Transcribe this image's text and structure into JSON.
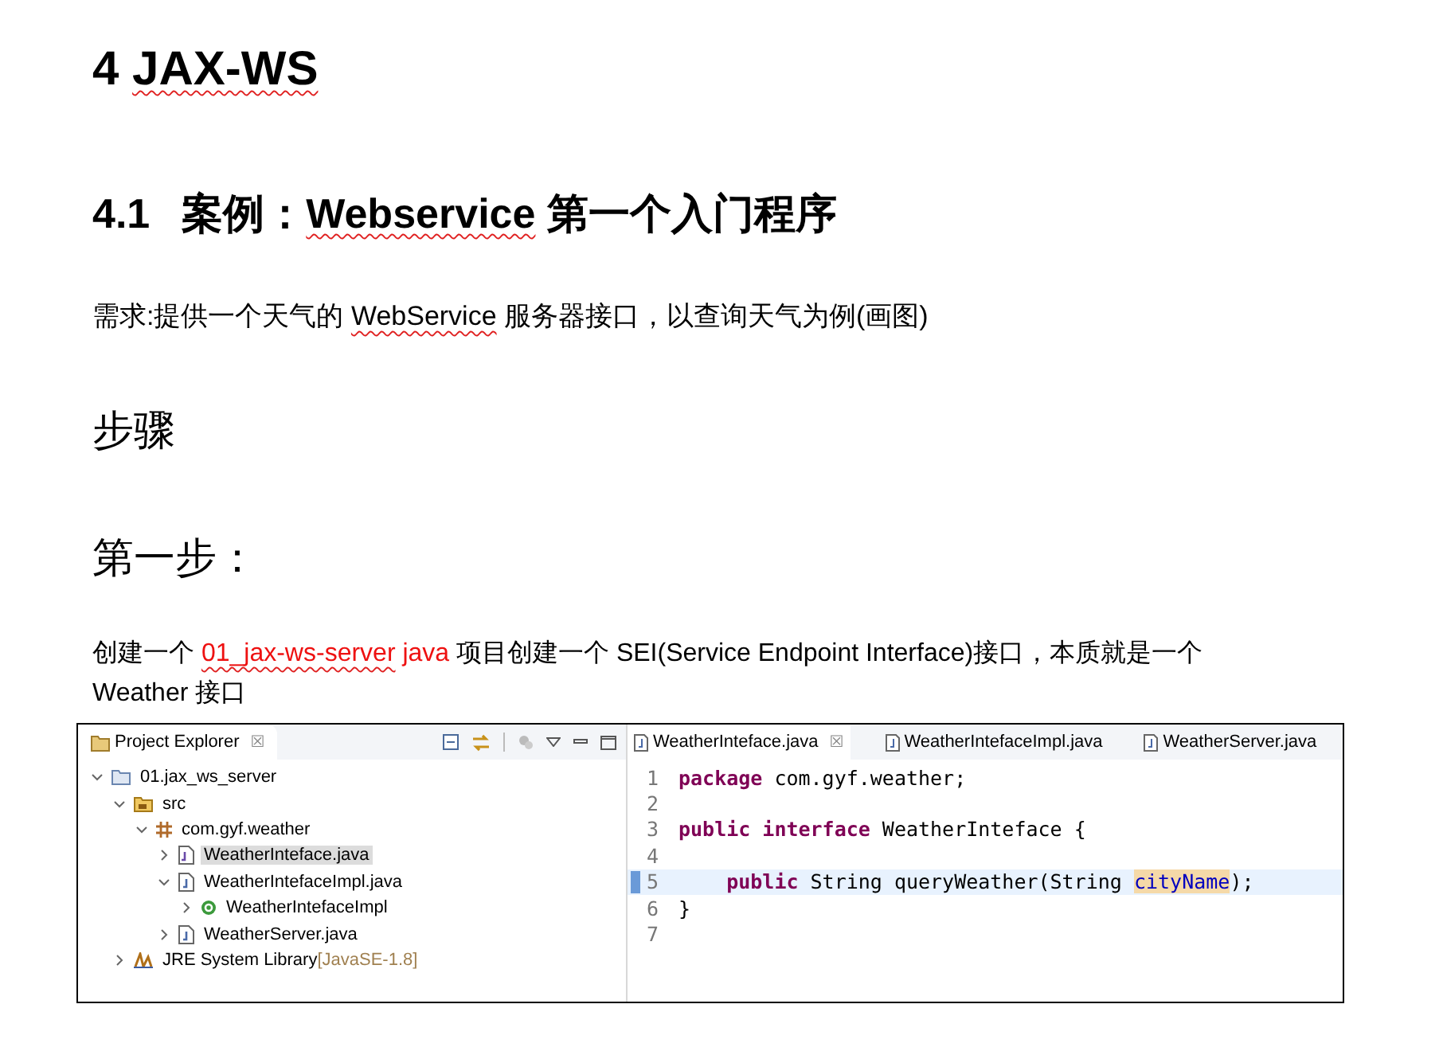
{
  "heading1": [
    {
      "text": "4 ",
      "misspelled": false
    },
    {
      "text": "JAX-WS",
      "misspelled": true
    }
  ],
  "heading2": {
    "number": "4.1",
    "title": [
      {
        "text": "案例：",
        "misspelled": false
      },
      {
        "text": "Webservice",
        "misspelled": true
      },
      {
        "text": " 第一个入门程序",
        "misspelled": false
      }
    ]
  },
  "requirement": [
    {
      "text": "需求:提供一个天气的 ",
      "misspelled": false
    },
    {
      "text": "WebService",
      "misspelled": true
    },
    {
      "text": " 服务器接口，以查询天气为例(画图)",
      "misspelled": false
    }
  ],
  "heading_steps": "步骤",
  "heading_step1": "第一步：",
  "paragraph": [
    {
      "text": "创建一个 ",
      "kind": "plain",
      "misspelled": false
    },
    {
      "text": "01_jax-ws-server",
      "kind": "red",
      "misspelled": true
    },
    {
      "text": " java",
      "kind": "red",
      "misspelled": false
    },
    {
      "text": " 项目创建一个 SEI(Service Endpoint Interface)接口，本质就是一个 Weather 接口",
      "kind": "plain",
      "misspelled": false
    }
  ],
  "ide": {
    "explorer": {
      "title": "Project Explorer",
      "close": "☒",
      "tree": [
        {
          "label": "01.jax_ws_server",
          "kind": "project",
          "expanded": true,
          "selected": false,
          "children": [
            {
              "label": "src",
              "kind": "source",
              "expanded": true,
              "selected": false,
              "children": [
                {
                  "label": "com.gyf.weather",
                  "kind": "package",
                  "expanded": true,
                  "selected": false,
                  "children": [
                    {
                      "label": "WeatherInteface.java",
                      "kind": "interface-file",
                      "expanded": false,
                      "selected": true
                    },
                    {
                      "label": "WeatherIntefaceImpl.java",
                      "kind": "java-file",
                      "expanded": true,
                      "selected": false,
                      "children": [
                        {
                          "label": "WeatherIntefaceImpl",
                          "kind": "class",
                          "expanded": false,
                          "selected": false
                        }
                      ]
                    },
                    {
                      "label": "WeatherServer.java",
                      "kind": "java-file",
                      "expanded": false,
                      "selected": false
                    }
                  ]
                }
              ]
            },
            {
              "label": "JRE System Library",
              "suffix": "[JavaSE-1.8]",
              "kind": "library",
              "expanded": false,
              "selected": false
            }
          ]
        }
      ]
    },
    "editor": {
      "tabs": [
        {
          "label": "WeatherInteface.java",
          "selected": true,
          "close": "☒"
        },
        {
          "label": "WeatherIntefaceImpl.java",
          "selected": false
        },
        {
          "label": "WeatherServer.java",
          "selected": false
        }
      ],
      "lines": [
        {
          "number": "1",
          "current": false,
          "tokens": [
            {
              "text": "package",
              "kind": "keyword"
            },
            {
              "text": "com.gyf.weather;",
              "kind": "plain"
            }
          ]
        },
        {
          "number": "2",
          "current": false
        },
        {
          "number": "3",
          "current": false,
          "tokens": [
            {
              "text": "public",
              "kind": "keyword"
            },
            {
              "text": "interface",
              "kind": "keyword"
            },
            {
              "text": "WeatherInteface {",
              "kind": "plain"
            }
          ]
        },
        {
          "number": "4",
          "current": false
        },
        {
          "number": "5",
          "current": true,
          "indented": true,
          "tokens": [
            {
              "text": "public",
              "kind": "keyword"
            },
            {
              "text": "String queryWeather(String ",
              "kind": "plain"
            },
            {
              "text": "cityName",
              "kind": "occurrence"
            },
            {
              "text": ");",
              "kind": "plain"
            }
          ]
        },
        {
          "number": "6",
          "current": false,
          "tokens": [
            {
              "text": "}",
              "kind": "plain"
            }
          ]
        },
        {
          "number": "7",
          "current": false
        }
      ]
    }
  }
}
